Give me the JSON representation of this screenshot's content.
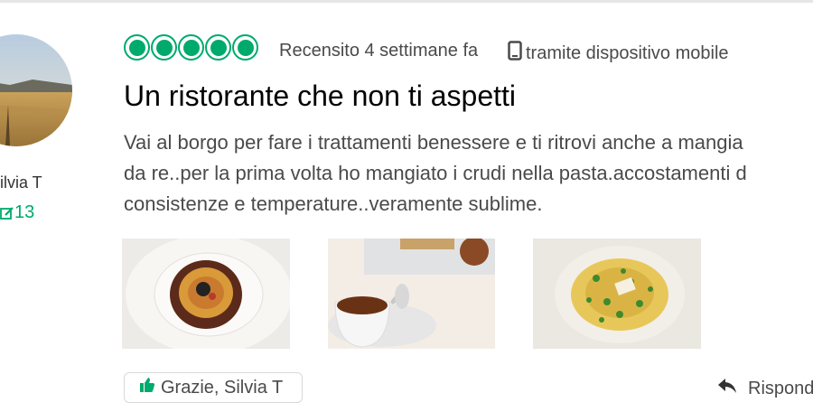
{
  "reviewer": {
    "name": "ilvia T",
    "contributions": "13",
    "contributions_icon": "pencil-edit-icon"
  },
  "review": {
    "rating": 5,
    "rating_max": 5,
    "accent_color": "#00aa6c",
    "reviewed": "Recensito 4 settimane fa",
    "device": "tramite dispositivo mobile",
    "device_icon": "mobile-phone-icon",
    "title": "Un ristorante che non ti aspetti",
    "body_lines": [
      "Vai al borgo per fare i trattamenti benessere e ti ritrovi anche a mangia",
      "da re..per la prima volta ho mangiato i crudi nella pasta.accostamenti d",
      "consistenze e temperature..veramente sublime."
    ]
  },
  "actions": {
    "thanks_label": "Grazie, Silvia T",
    "thanks_icon": "thumbs-up-icon",
    "reply_label": "Rispond",
    "reply_icon": "reply-arrow-icon"
  }
}
